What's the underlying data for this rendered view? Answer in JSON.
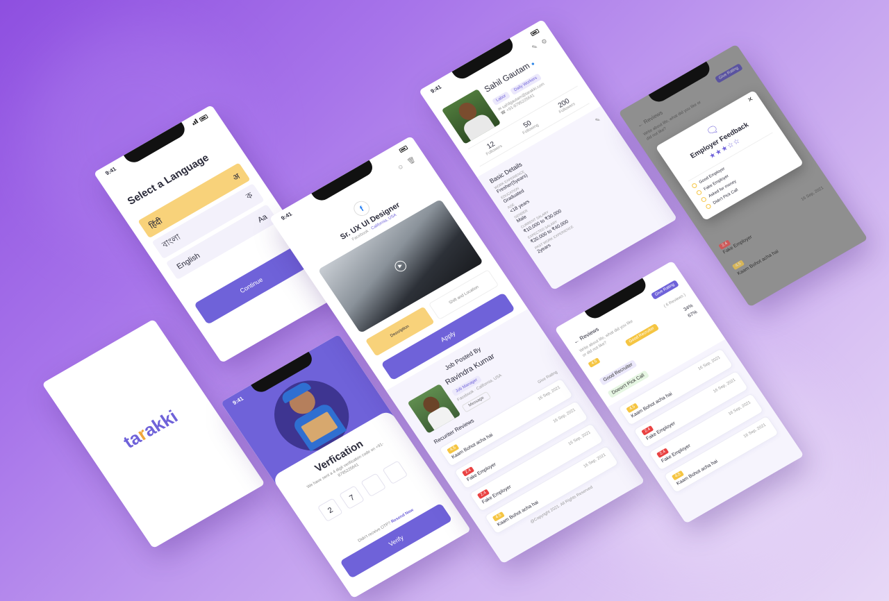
{
  "brand": {
    "logo_prefix": "ta",
    "logo_r": "r",
    "logo_suffix": "akki",
    "accent": "#6f62d9"
  },
  "status_time": "9:41",
  "language": {
    "title": "Select a Language",
    "options": [
      {
        "label": "हिंदी",
        "glyph": "अ"
      },
      {
        "label": "বাংলা",
        "glyph": "ক"
      },
      {
        "label": "English",
        "glyph": "Aa"
      }
    ],
    "continue": "Continue"
  },
  "verification": {
    "title": "Verfication",
    "subtitle": "We have sent a 4 digit verification code on +91-8795225641",
    "otp": [
      "2",
      "7",
      "",
      ""
    ],
    "resend_prompt": "Didn't receive OTP?",
    "resend_link": "Resend Now",
    "verify": "Verify"
  },
  "job": {
    "title": "Sr. UX UI Designer",
    "company": "Facebook",
    "location": "California, USA",
    "tabs": [
      "Description",
      "Shift and Location"
    ],
    "apply": "Apply",
    "posted_by_label": "Job Posted By",
    "poster_name": "Ravindra Kumar",
    "poster_role": "Job Manager",
    "poster_company": "Facebook · California, USA",
    "message": "Message",
    "reviews_title": "Recuriter Reviews",
    "give_rating": "Give Rating",
    "reviews": [
      {
        "rating": "4.5",
        "text": "Kaam Bohot acha hai",
        "date": "16 Sep, 2021",
        "color": "y"
      },
      {
        "rating": "2.4",
        "text": "Fake Employer",
        "date": "16 Sep, 2021",
        "color": "r"
      },
      {
        "rating": "2.4",
        "text": "Fake Employer",
        "date": "16 Sep, 2021",
        "color": "r"
      },
      {
        "rating": "4.5",
        "text": "Kaam Bohot acha hai",
        "date": "16 Sep, 2021",
        "color": "y"
      }
    ],
    "footer": "@Copyright 2021. All Rights Reserved"
  },
  "profile": {
    "name": "Sahil Gautam",
    "tags": [
      "Labor",
      "Daily Workers"
    ],
    "email": "sahilgautam@tarakki.com",
    "phone": "+91-8795225641",
    "stats": [
      {
        "value": "12",
        "label": "Followers"
      },
      {
        "value": "50",
        "label": "Following"
      },
      {
        "value": "200",
        "label": "Followers"
      }
    ],
    "basic_title": "Basic Details",
    "details": [
      {
        "label": "WORK EXPERIENCE",
        "value": "Fresher(5years)"
      },
      {
        "label": "EDUCATION",
        "value": "Graduated"
      },
      {
        "label": "AGE",
        "value": "<18 years"
      },
      {
        "label": "GENDER",
        "value": "Male"
      },
      {
        "label": "CURRENT SALARY",
        "value": "₹10,000 to ₹30,000"
      },
      {
        "label": "EXPECTED SALARY",
        "value": "₹20,000 to ₹40,000"
      },
      {
        "label": "PAST WORK EXPERIENCE",
        "value": "2years"
      }
    ]
  },
  "reviews_screen": {
    "title": "Reviews",
    "give_rating": "Give Rating",
    "prompt": "Write about life, what did you like or did not like?",
    "count": "( 6 Reviews )",
    "pct1": "34%",
    "pct2": "67%",
    "badges": [
      "Good Recruiter",
      "Doesn't Pick Call"
    ],
    "good_tag": "Good Recruiter",
    "items": [
      {
        "rating": "4.5",
        "text": "Kaam Bohot acha hai",
        "date": "16 Sep, 2021",
        "color": "y"
      },
      {
        "rating": "2.4",
        "text": "Fake Employer",
        "date": "16 Sep, 2021",
        "color": "r"
      },
      {
        "rating": "2.4",
        "text": "Fake Employer",
        "date": "16 Sep, 2021",
        "color": "r"
      },
      {
        "rating": "4.5",
        "text": "Kaam Bohot acha hai",
        "date": "16 Sep, 2021",
        "color": "y"
      }
    ]
  },
  "feedback": {
    "title": "Employer Feedback",
    "stars_filled": 3,
    "stars_total": 5,
    "options": [
      "Good Employer",
      "Fake Employer",
      "Asked for money",
      "Didn't Pick Call"
    ],
    "bg_items": [
      "Fake Employer",
      "Kaam Bohot acha hai"
    ],
    "bg_date": "16 Sep, 2021",
    "bg_title": "Reviews",
    "bg_give_rating": "Give Rating",
    "bg_prompt": "Write about life, what did you like or did not like?",
    "bg_ratings": [
      "2.4",
      "4.5"
    ]
  }
}
